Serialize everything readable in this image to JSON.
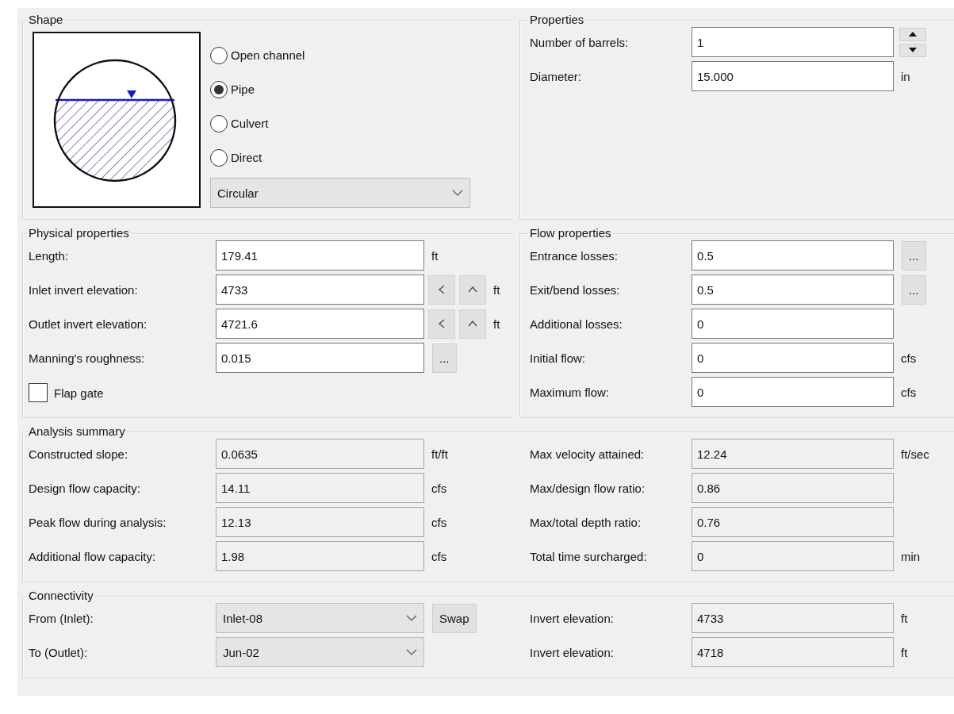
{
  "shape": {
    "title": "Shape",
    "options": [
      {
        "label": "Open channel",
        "selected": false
      },
      {
        "label": "Pipe",
        "selected": true
      },
      {
        "label": "Culvert",
        "selected": false
      },
      {
        "label": "Direct",
        "selected": false
      }
    ],
    "dropdown": {
      "value": "Circular"
    }
  },
  "properties": {
    "title": "Properties",
    "fields": [
      {
        "label": "Number of barrels:",
        "kind": "spin",
        "value": "1"
      },
      {
        "label": "Diameter:",
        "kind": "input",
        "value": "15.000",
        "unit": "in"
      }
    ]
  },
  "physical_properties": {
    "title": "Physical properties",
    "fields": [
      {
        "label": "Length:",
        "kind": "input",
        "value": "179.41",
        "unit": "ft"
      },
      {
        "label": "Inlet invert elevation:",
        "kind": "elevation",
        "value": "4733",
        "unit": "ft"
      },
      {
        "label": "Outlet invert elevation:",
        "kind": "elevation",
        "value": "4721.6",
        "unit": "ft"
      },
      {
        "label": "Manning's roughness:",
        "kind": "input",
        "value": "0.015",
        "button": "..."
      }
    ],
    "flap_gate": {
      "label": "Flap gate",
      "checked": false
    }
  },
  "flow_properties": {
    "title": "Flow properties",
    "fields": [
      {
        "label": "Entrance losses:",
        "kind": "input",
        "value": "0.5",
        "button": "..."
      },
      {
        "label": "Exit/bend losses:",
        "kind": "input",
        "value": "0.5",
        "button": "..."
      },
      {
        "label": "Additional losses:",
        "kind": "input",
        "value": "0"
      },
      {
        "label": "Initial flow:",
        "kind": "input",
        "value": "0",
        "unit": "cfs"
      },
      {
        "label": "Maximum flow:",
        "kind": "input",
        "value": "0",
        "unit": "cfs"
      }
    ]
  },
  "analysis_summary": {
    "title": "Analysis summary",
    "left": [
      {
        "label": "Constructed slope:",
        "kind": "readout",
        "value": "0.0635",
        "unit": "ft/ft"
      },
      {
        "label": "Design flow capacity:",
        "kind": "readout",
        "value": "14.11",
        "unit": "cfs"
      },
      {
        "label": "Peak flow during analysis:",
        "kind": "readout",
        "value": "12.13",
        "unit": "cfs"
      },
      {
        "label": "Additional flow capacity:",
        "kind": "readout",
        "value": "1.98",
        "unit": "cfs"
      }
    ],
    "right": [
      {
        "label": "Max velocity attained:",
        "kind": "readout",
        "value": "12.24",
        "unit": "ft/sec"
      },
      {
        "label": "Max/design flow ratio:",
        "kind": "readout",
        "value": "0.86"
      },
      {
        "label": "Max/total depth ratio:",
        "kind": "readout",
        "value": "0.76"
      },
      {
        "label": "Total time surcharged:",
        "kind": "readout",
        "value": "0",
        "unit": "min"
      }
    ]
  },
  "connectivity": {
    "title": "Connectivity",
    "left": [
      {
        "label": "From (Inlet):",
        "kind": "dropdown",
        "value": "Inlet-08",
        "button": "Swap"
      },
      {
        "label": "To (Outlet):",
        "kind": "dropdown",
        "value": "Jun-02"
      }
    ],
    "right": [
      {
        "label": "Invert elevation:",
        "kind": "readout",
        "value": "4733",
        "unit": "ft"
      },
      {
        "label": "Invert elevation:",
        "kind": "readout",
        "value": "4718",
        "unit": "ft"
      }
    ]
  }
}
